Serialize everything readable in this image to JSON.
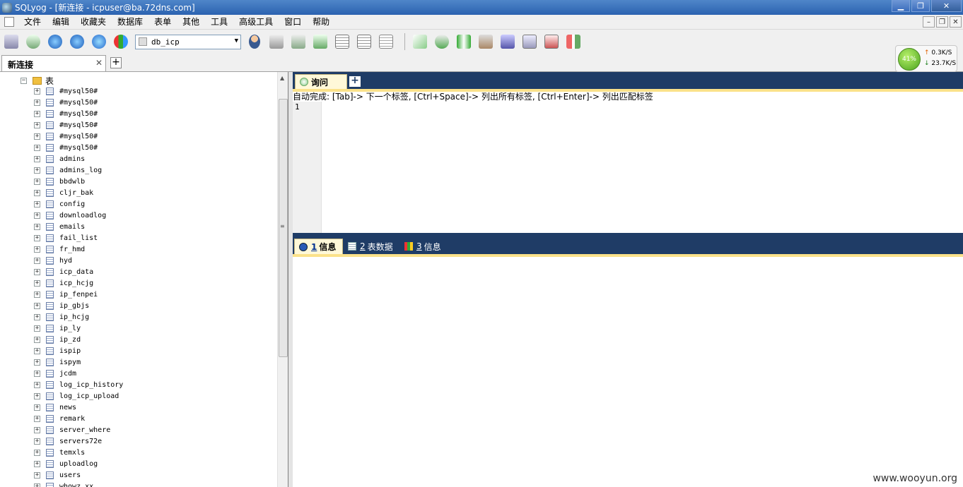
{
  "window": {
    "title": "SQLyog - [新连接 - icpuser@ba.72dns.com]",
    "minimize": "▁",
    "maximize": "❐",
    "close": "✕"
  },
  "menu": {
    "items": [
      "文件",
      "编辑",
      "收藏夹",
      "数据库",
      "表单",
      "其他",
      "工具",
      "高级工具",
      "窗口",
      "帮助"
    ],
    "mdi": {
      "minimize": "–",
      "restore": "❐",
      "close": "✕"
    }
  },
  "toolbar": {
    "database": "db_icp",
    "dropdown_glyph": "▼"
  },
  "connection_tabs": [
    {
      "label": "新连接",
      "close": "✕"
    }
  ],
  "add_tab_glyph": "+",
  "network": {
    "percent": "41%",
    "upload": "0.3K/S",
    "download": "23.7K/S",
    "up_arrow": "↑",
    "down_arrow": "↓"
  },
  "tree": {
    "root": {
      "expander": "−",
      "label": "表"
    },
    "expander": "+",
    "tables": [
      "#mysql50#",
      "#mysql50#",
      "#mysql50#",
      "#mysql50#",
      "#mysql50#",
      "#mysql50#",
      "admins",
      "admins_log",
      "bbdwlb",
      "cljr_bak",
      "config",
      "downloadlog",
      "emails",
      "fail_list",
      "fr_hmd",
      "hyd",
      "icp_data",
      "icp_hcjg",
      "ip_fenpei",
      "ip_gbjs",
      "ip_hcjg",
      "ip_ly",
      "ip_zd",
      "ispip",
      "ispym",
      "jcdm",
      "log_icp_history",
      "log_icp_upload",
      "news",
      "remark",
      "server_where",
      "servers72e",
      "temxls",
      "uploadlog",
      "users",
      "whowz_xx"
    ]
  },
  "scrollbar": {
    "up": "▲",
    "grip": "≡"
  },
  "query": {
    "tab_label": "询问",
    "add_glyph": "+",
    "hint": "自动完成: [Tab]-> 下一个标签, [Ctrl+Space]-> 列出所有标签, [Ctrl+Enter]-> 列出匹配标签",
    "line_number": "1"
  },
  "result_tabs": [
    {
      "num": "1",
      "label": "信息"
    },
    {
      "num": "2",
      "label": "表数据"
    },
    {
      "num": "3",
      "label": "信息"
    }
  ],
  "watermark": "www.wooyun.org"
}
